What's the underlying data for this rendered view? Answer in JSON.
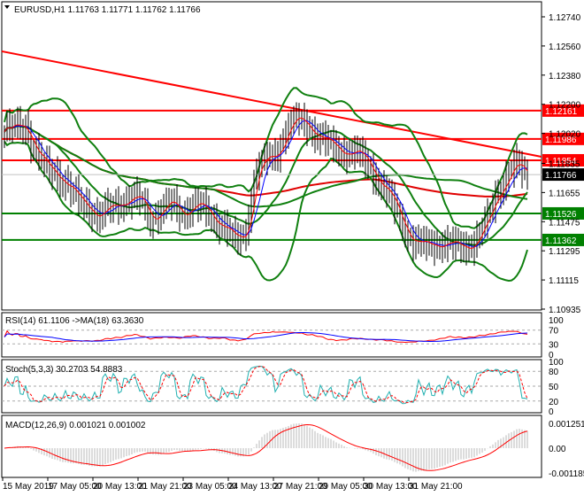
{
  "chart_data": {
    "type": "line",
    "title": "EURUSD,H1  1.11763 1.11771 1.11762 1.11766",
    "symbol": "EURUSD,H1",
    "ohlc_text": "1.11763 1.11771 1.11762 1.11766",
    "price_ticks": [
      "1.12740",
      "1.12560",
      "1.12380",
      "1.12200",
      "1.12020",
      "1.11835",
      "1.11655",
      "1.11475",
      "1.11295",
      "1.11115",
      "1.10935"
    ],
    "ylim": [
      1.10935,
      1.1274
    ],
    "current_price": "1.11766",
    "levels": [
      {
        "label": "1.12161",
        "value": 1.12161,
        "color": "#ff0000"
      },
      {
        "label": "1.11986",
        "value": 1.11986,
        "color": "#ff0000"
      },
      {
        "label": "1.11854",
        "value": 1.11854,
        "color": "#ff0000"
      },
      {
        "label": "1.11526",
        "value": 1.11526,
        "color": "#008000"
      },
      {
        "label": "1.11362",
        "value": 1.11362,
        "color": "#008000"
      }
    ],
    "trendline": {
      "start": 1.12527,
      "end": 1.11876,
      "color": "#ff0000"
    },
    "close_series": [
      1.1203,
      1.1205,
      1.1208,
      1.119,
      1.118,
      1.1178,
      1.117,
      1.116,
      1.1158,
      1.115,
      1.1155,
      1.116,
      1.1162,
      1.116,
      1.115,
      1.1155,
      1.1158,
      1.1153,
      1.1158,
      1.1155,
      1.115,
      1.1145,
      1.1135,
      1.114,
      1.1178,
      1.1185,
      1.119,
      1.1205,
      1.121,
      1.1208,
      1.12,
      1.1195,
      1.1193,
      1.119,
      1.1188,
      1.1182,
      1.117,
      1.116,
      1.1148,
      1.1135,
      1.1132,
      1.1135,
      1.1134,
      1.1132,
      1.1133,
      1.1135,
      1.1145,
      1.1165,
      1.1175,
      1.1182,
      1.11766
    ],
    "rsi": {
      "label": "RSI(14) 61.1106  ->MA(18) 63.3630",
      "ticks": [
        "100",
        "70",
        "30",
        "0"
      ]
    },
    "stoch": {
      "label": "Stoch(5,3,3) 30.2703 54.8883",
      "ticks": [
        "100",
        "80",
        "50",
        "20",
        "0"
      ]
    },
    "macd": {
      "label": "MACD(12,26,9) 0.001021 0.001002",
      "ticks": [
        "0.001251",
        "0.00",
        "-0.001185"
      ]
    },
    "x_labels": [
      "15 May 2019",
      "17 May 05:00",
      "20 May 13:00",
      "21 May 21:00",
      "23 May 05:00",
      "24 May 13:00",
      "27 May 21:00",
      "29 May 05:00",
      "30 May 13:00",
      "31 May 21:00"
    ]
  }
}
